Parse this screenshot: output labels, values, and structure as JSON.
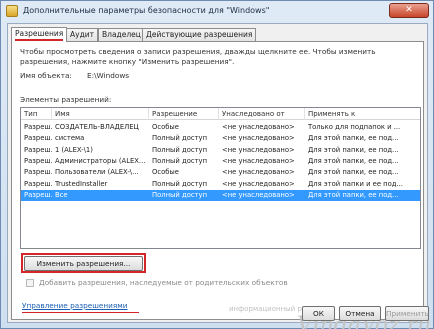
{
  "window": {
    "title": "Дополнительные параметры безопасности  для \"Windows\"",
    "close_glyph": "✕"
  },
  "tabs": [
    {
      "label": "Разрешения",
      "active": true
    },
    {
      "label": "Аудит",
      "active": false
    },
    {
      "label": "Владелец",
      "active": false
    },
    {
      "label": "Действующие разрешения",
      "active": false
    }
  ],
  "panel": {
    "description": "Чтобы просмотреть сведения о записи разрешения, дважды щелкните ее. Чтобы изменить разрешения, нажмите кнопку \"Изменить разрешения\".",
    "object_name_label": "Имя объекта:",
    "object_name_value": "E:\\Windows",
    "entries_label": "Элементы разрешений:"
  },
  "table": {
    "columns": [
      "Тип",
      "Имя",
      "Разрешение",
      "Унаследовано от",
      "Применять к"
    ],
    "rows": [
      {
        "type": "Разреш...",
        "name": "СОЗДАТЕЛЬ-ВЛАДЕЛЕЦ",
        "permission": "Особые",
        "inherited": "<не унаследовано>",
        "apply": "Только для подпапок и ..."
      },
      {
        "type": "Разреш...",
        "name": "система",
        "permission": "Полный доступ",
        "inherited": "<не унаследовано>",
        "apply": "Для этой папки, ее под..."
      },
      {
        "type": "Разреш...",
        "name": "1 (ALEX-\\1)",
        "permission": "Полный доступ",
        "inherited": "<не унаследовано>",
        "apply": "Для этой папки, ее под..."
      },
      {
        "type": "Разреш...",
        "name": "Администраторы (ALEX...",
        "permission": "Полный доступ",
        "inherited": "<не унаследовано>",
        "apply": "Для этой папки, ее под..."
      },
      {
        "type": "Разреш...",
        "name": "Пользователи (ALEX-\\...",
        "permission": "Особые",
        "inherited": "<не унаследовано>",
        "apply": "Для этой папки, ее под..."
      },
      {
        "type": "Разреш...",
        "name": "TrustedInstaller",
        "permission": "Полный доступ",
        "inherited": "<не унаследовано>",
        "apply": "Для этой папки и ее под..."
      },
      {
        "type": "Разреш...",
        "name": "Все",
        "permission": "Полный доступ",
        "inherited": "<не унаследовано>",
        "apply": "Для этой папки, ее под...",
        "selected": true
      }
    ]
  },
  "buttons": {
    "change_permissions": "Изменить разрешения...",
    "ok": "ОК",
    "cancel": "Отмена",
    "apply": "Применить"
  },
  "inherit_checkbox": {
    "label": "Добавить разрешения, наследуемые от родительских объектов",
    "checked": false,
    "enabled": false
  },
  "manage_link": "Управление разрешениями",
  "watermark": {
    "large": "VindaVoz.ru",
    "small": "информационный ресурс"
  },
  "colors": {
    "accent_red": "#d3262a",
    "selection": "#3399ff",
    "link": "#1a5fb4"
  }
}
